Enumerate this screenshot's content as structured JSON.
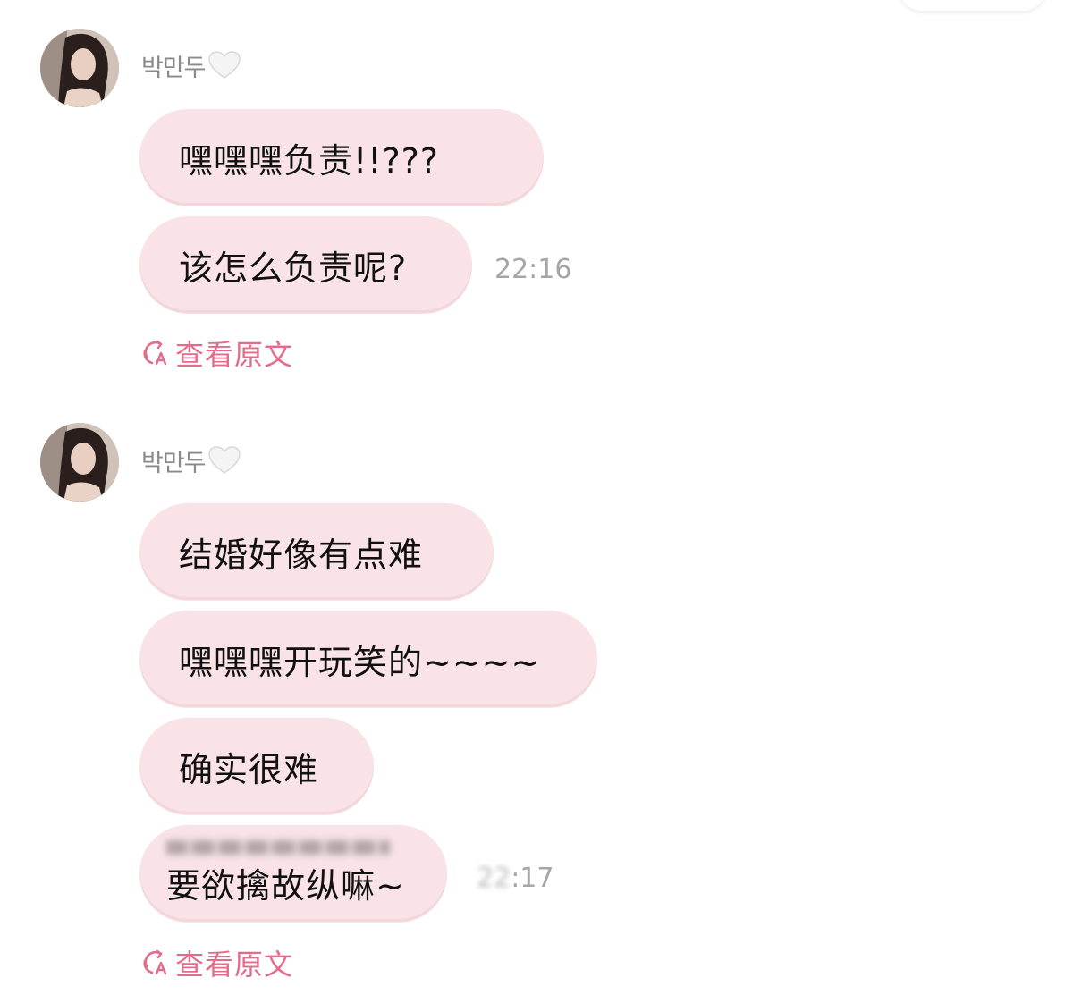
{
  "colors": {
    "bubble_bg": "#f9e3e7",
    "link_pink": "#e46b8a",
    "name_gray": "#8a8a8a",
    "time_gray": "#a6a6a6"
  },
  "groups": [
    {
      "sender": {
        "name": "박만두",
        "emoji_icon": "white-heart-icon",
        "avatar_icon": "profile-photo"
      },
      "messages": [
        {
          "text": "嘿嘿嘿负责!!???"
        },
        {
          "text": "该怎么负责呢?"
        }
      ],
      "timestamp": "22:16",
      "view_original": "查看原文"
    },
    {
      "sender": {
        "name": "박만두",
        "emoji_icon": "white-heart-icon",
        "avatar_icon": "profile-photo"
      },
      "messages": [
        {
          "text": "结婚好像有点难"
        },
        {
          "text": "嘿嘿嘿开玩笑的~~~~"
        },
        {
          "text": "确实很难"
        },
        {
          "text": "要欲擒故纵嘛~",
          "blurred_overlay": true
        }
      ],
      "timestamp": "22:17",
      "view_original": "查看原文"
    }
  ]
}
